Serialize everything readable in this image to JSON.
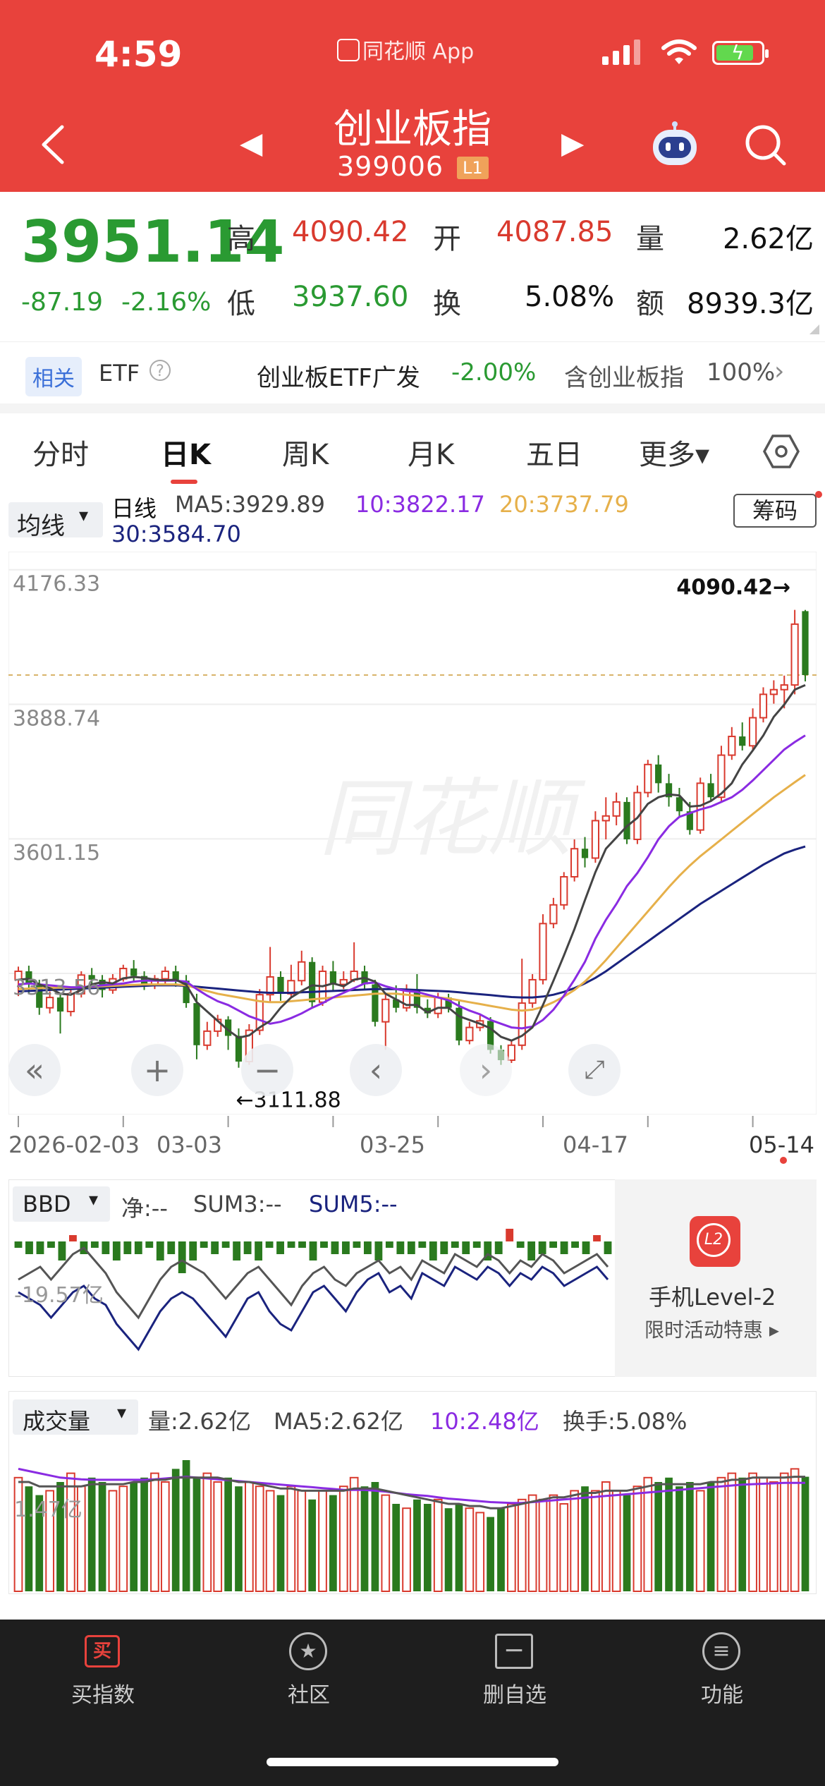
{
  "status": {
    "time": "4:59",
    "app": "同花顺 App"
  },
  "header": {
    "title": "创业板指",
    "code": "399006",
    "level": "L1"
  },
  "quote": {
    "price": "3951.14",
    "change": "-87.19",
    "change_pct": "-2.16%",
    "labels": {
      "high": "高",
      "open": "开",
      "volume": "量",
      "low": "低",
      "turnover": "换",
      "amount": "额"
    },
    "high": "4090.42",
    "open": "4087.85",
    "volume": "2.62亿",
    "low": "3937.60",
    "turnover": "5.08%",
    "amount": "8939.3亿"
  },
  "etf": {
    "tag": "相关",
    "label": "ETF",
    "help": "?",
    "name": "创业板ETF广发",
    "change": "-2.00%",
    "contains": "含创业板指",
    "pct": "100%",
    "chevron": "›"
  },
  "tabs": [
    "分时",
    "日K",
    "周K",
    "月K",
    "五日",
    "更多▾"
  ],
  "ma": {
    "select": "均线",
    "line_label": "日线",
    "ma5": "MA5:3929.89",
    "ma10": "10:3822.17",
    "ma20": "20:3737.79",
    "ma30": "30:3584.70",
    "chip": "筹码"
  },
  "colors": {
    "up": "#d93a2e",
    "down": "#2a7a1e",
    "ma5": "#444444",
    "ma10": "#8a2be2",
    "ma20": "#e6b04a",
    "ma30": "#1a237e",
    "brand": "#e8423c"
  },
  "chart_data": {
    "type": "candlestick",
    "y_ticks": [
      "4176.33",
      "3888.74",
      "3601.15",
      "3313.56"
    ],
    "ylim": [
      3024,
      4200
    ],
    "dates": [
      "2026-02-03",
      "03-03",
      "03-25",
      "04-17",
      "05-14"
    ],
    "high_marker": "4090.42→",
    "low_marker": "←3111.88",
    "last_price": 3951.14,
    "candles": [
      [
        3300,
        3318,
        3265,
        3328
      ],
      [
        3318,
        3290,
        3270,
        3330
      ],
      [
        3290,
        3240,
        3225,
        3300
      ],
      [
        3240,
        3262,
        3228,
        3275
      ],
      [
        3262,
        3232,
        3185,
        3270
      ],
      [
        3232,
        3270,
        3222,
        3282
      ],
      [
        3270,
        3310,
        3262,
        3318
      ],
      [
        3310,
        3300,
        3284,
        3325
      ],
      [
        3300,
        3278,
        3262,
        3310
      ],
      [
        3278,
        3302,
        3270,
        3312
      ],
      [
        3302,
        3324,
        3296,
        3332
      ],
      [
        3324,
        3308,
        3294,
        3342
      ],
      [
        3308,
        3288,
        3278,
        3318
      ],
      [
        3288,
        3302,
        3280,
        3310
      ],
      [
        3302,
        3318,
        3290,
        3328
      ],
      [
        3318,
        3298,
        3285,
        3330
      ],
      [
        3298,
        3250,
        3240,
        3310
      ],
      [
        3250,
        3160,
        3130,
        3270
      ],
      [
        3160,
        3190,
        3150,
        3210
      ],
      [
        3190,
        3215,
        3178,
        3225
      ],
      [
        3215,
        3180,
        3150,
        3222
      ],
      [
        3180,
        3125,
        3111.88,
        3196
      ],
      [
        3125,
        3192,
        3118,
        3205
      ],
      [
        3192,
        3268,
        3182,
        3280
      ],
      [
        3268,
        3306,
        3254,
        3370
      ],
      [
        3306,
        3270,
        3255,
        3318
      ],
      [
        3270,
        3298,
        3262,
        3332
      ],
      [
        3298,
        3338,
        3288,
        3362
      ],
      [
        3338,
        3252,
        3240,
        3348
      ],
      [
        3252,
        3318,
        3244,
        3330
      ],
      [
        3318,
        3290,
        3278,
        3340
      ],
      [
        3290,
        3300,
        3280,
        3318
      ],
      [
        3300,
        3318,
        3295,
        3380
      ],
      [
        3318,
        3290,
        3280,
        3330
      ],
      [
        3290,
        3210,
        3200,
        3300
      ],
      [
        3210,
        3258,
        3150,
        3268
      ],
      [
        3258,
        3240,
        3230,
        3288
      ],
      [
        3240,
        3278,
        3232,
        3290
      ],
      [
        3278,
        3240,
        3228,
        3312
      ],
      [
        3240,
        3228,
        3218,
        3258
      ],
      [
        3228,
        3262,
        3218,
        3272
      ],
      [
        3262,
        3240,
        3230,
        3270
      ],
      [
        3240,
        3170,
        3160,
        3255
      ],
      [
        3170,
        3198,
        3162,
        3210
      ],
      [
        3198,
        3212,
        3190,
        3224
      ],
      [
        3212,
        3150,
        3142,
        3220
      ],
      [
        3150,
        3128,
        3118,
        3160
      ],
      [
        3128,
        3160,
        3122,
        3172
      ],
      [
        3160,
        3250,
        3150,
        3345
      ],
      [
        3250,
        3300,
        3240,
        3312
      ],
      [
        3300,
        3420,
        3290,
        3440
      ],
      [
        3420,
        3460,
        3410,
        3475
      ],
      [
        3460,
        3520,
        3450,
        3530
      ],
      [
        3520,
        3580,
        3510,
        3600
      ],
      [
        3580,
        3560,
        3540,
        3605
      ],
      [
        3560,
        3640,
        3550,
        3660
      ],
      [
        3640,
        3650,
        3600,
        3690
      ],
      [
        3650,
        3680,
        3630,
        3700
      ],
      [
        3680,
        3600,
        3590,
        3690
      ],
      [
        3600,
        3700,
        3590,
        3715
      ],
      [
        3700,
        3760,
        3690,
        3770
      ],
      [
        3760,
        3720,
        3700,
        3780
      ],
      [
        3720,
        3690,
        3670,
        3740
      ],
      [
        3690,
        3660,
        3650,
        3710
      ],
      [
        3660,
        3620,
        3610,
        3680
      ],
      [
        3620,
        3720,
        3612,
        3732
      ],
      [
        3720,
        3690,
        3680,
        3740
      ],
      [
        3690,
        3780,
        3682,
        3800
      ],
      [
        3780,
        3820,
        3770,
        3840
      ],
      [
        3820,
        3800,
        3790,
        3850
      ],
      [
        3800,
        3860,
        3790,
        3880
      ],
      [
        3860,
        3910,
        3850,
        3925
      ],
      [
        3910,
        3920,
        3890,
        3940
      ],
      [
        3920,
        3930,
        3880,
        3950
      ],
      [
        3930,
        4060,
        3910,
        4090.42
      ],
      [
        4087.85,
        3951.14,
        3937.6,
        4090.42
      ]
    ],
    "ma5": [
      3300,
      3302,
      3290,
      3282,
      3270,
      3268,
      3278,
      3290,
      3295,
      3292,
      3303,
      3306,
      3304,
      3300,
      3299,
      3300,
      3289,
      3252,
      3232,
      3212,
      3192,
      3176,
      3181,
      3198,
      3212,
      3240,
      3262,
      3276,
      3288,
      3286,
      3292,
      3286,
      3300,
      3304,
      3296,
      3270,
      3258,
      3246,
      3246,
      3230,
      3240,
      3240,
      3222,
      3214,
      3206,
      3196,
      3178,
      3170,
      3180,
      3198,
      3246,
      3298,
      3352,
      3408,
      3470,
      3530,
      3580,
      3604,
      3628,
      3646,
      3676,
      3690,
      3696,
      3694,
      3670,
      3672,
      3682,
      3698,
      3720,
      3760,
      3790,
      3822,
      3862,
      3888,
      3920,
      3929.89
    ],
    "ma10": [
      3290,
      3292,
      3290,
      3288,
      3286,
      3284,
      3284,
      3286,
      3288,
      3290,
      3292,
      3296,
      3298,
      3298,
      3298,
      3298,
      3296,
      3280,
      3266,
      3254,
      3246,
      3234,
      3222,
      3214,
      3206,
      3210,
      3218,
      3228,
      3240,
      3250,
      3262,
      3272,
      3282,
      3292,
      3294,
      3286,
      3280,
      3276,
      3274,
      3268,
      3262,
      3256,
      3244,
      3234,
      3226,
      3214,
      3206,
      3198,
      3196,
      3200,
      3214,
      3236,
      3266,
      3300,
      3338,
      3388,
      3428,
      3462,
      3500,
      3528,
      3562,
      3600,
      3628,
      3648,
      3656,
      3664,
      3670,
      3680,
      3690,
      3706,
      3726,
      3748,
      3770,
      3792,
      3808,
      3822.17
    ],
    "ma20": [
      3280,
      3281,
      3282,
      3283,
      3283,
      3283,
      3284,
      3285,
      3286,
      3287,
      3288,
      3289,
      3290,
      3290,
      3290,
      3290,
      3288,
      3282,
      3276,
      3270,
      3266,
      3262,
      3258,
      3254,
      3252,
      3252,
      3254,
      3256,
      3258,
      3260,
      3262,
      3264,
      3266,
      3268,
      3270,
      3270,
      3270,
      3268,
      3266,
      3264,
      3262,
      3260,
      3256,
      3252,
      3248,
      3244,
      3240,
      3236,
      3234,
      3236,
      3242,
      3252,
      3264,
      3278,
      3296,
      3318,
      3342,
      3368,
      3394,
      3420,
      3446,
      3472,
      3498,
      3522,
      3544,
      3564,
      3582,
      3600,
      3618,
      3636,
      3654,
      3672,
      3690,
      3706,
      3722,
      3737.79
    ],
    "ma30": [
      3275,
      3276,
      3277,
      3278,
      3279,
      3280,
      3281,
      3282,
      3283,
      3284,
      3285,
      3286,
      3287,
      3288,
      3288,
      3288,
      3287,
      3285,
      3283,
      3281,
      3279,
      3277,
      3275,
      3273,
      3272,
      3272,
      3272,
      3273,
      3274,
      3275,
      3276,
      3277,
      3278,
      3279,
      3280,
      3280,
      3280,
      3279,
      3278,
      3277,
      3276,
      3275,
      3273,
      3271,
      3269,
      3267,
      3265,
      3263,
      3262,
      3262,
      3264,
      3268,
      3274,
      3282,
      3292,
      3304,
      3318,
      3334,
      3350,
      3366,
      3382,
      3398,
      3414,
      3430,
      3446,
      3462,
      3476,
      3490,
      3504,
      3518,
      3532,
      3546,
      3558,
      3570,
      3578,
      3584.7
    ]
  },
  "controls": {
    "rewind": "«",
    "zoom_in": "+",
    "zoom_out": "−",
    "left": "‹",
    "right": "›",
    "fullscreen": "⤢"
  },
  "bbd": {
    "select": "BBD",
    "net": "净:--",
    "sum3": "SUM3:--",
    "sum5": "SUM5:--",
    "axis": "-19.57亿",
    "bars": [
      -1,
      -2,
      -2,
      -1,
      -3,
      1,
      -2,
      -1,
      -2,
      -3,
      -2,
      -2,
      -1,
      -3,
      -2,
      -5,
      -3,
      -1,
      -2,
      -1,
      -3,
      -2,
      -3,
      -1,
      -2,
      -1,
      -1,
      -3,
      -1,
      -2,
      -2,
      -1,
      -2,
      -3,
      -1,
      -2,
      -2,
      -1,
      -3,
      -2,
      -1,
      -2,
      -1,
      -3,
      -2,
      2,
      -1,
      -3,
      -2,
      -1,
      -2,
      -1,
      -2,
      1,
      -2
    ],
    "line1": [
      -6,
      -5,
      -4,
      -6,
      -4,
      -2,
      -1,
      -3,
      -5,
      -8,
      -10,
      -12,
      -9,
      -6,
      -4,
      -3,
      -4,
      -5,
      -7,
      -9,
      -7,
      -5,
      -4,
      -6,
      -8,
      -10,
      -7,
      -5,
      -4,
      -6,
      -7,
      -5,
      -4,
      -3,
      -5,
      -4,
      -6,
      -3,
      -4,
      -5,
      -2,
      -3,
      -4,
      -2,
      -3,
      -5,
      -3,
      -4,
      -2,
      -3,
      -5,
      -4,
      -3,
      -2,
      -4
    ],
    "line2": [
      -8,
      -9,
      -10,
      -12,
      -10,
      -8,
      -7,
      -9,
      -10,
      -13,
      -15,
      -17,
      -14,
      -11,
      -9,
      -8,
      -9,
      -11,
      -13,
      -15,
      -12,
      -9,
      -8,
      -11,
      -13,
      -14,
      -11,
      -8,
      -7,
      -9,
      -11,
      -8,
      -6,
      -5,
      -8,
      -7,
      -9,
      -5,
      -6,
      -7,
      -4,
      -5,
      -6,
      -4,
      -5,
      -7,
      -5,
      -6,
      -4,
      -5,
      -7,
      -6,
      -5,
      -4,
      -6
    ]
  },
  "promo": {
    "logo": "L2",
    "title": "手机Level-2",
    "subtitle": "限时活动特惠 ▸"
  },
  "volume": {
    "select": "成交量",
    "vol": "量:2.62亿",
    "ma5": "MA5:2.62亿",
    "ma10": "10:2.48亿",
    "turnover": "换手:5.08%",
    "axis": "1.47亿",
    "bars": [
      2.6,
      2.4,
      2.2,
      2.3,
      2.5,
      2.7,
      2.4,
      2.6,
      2.5,
      2.3,
      2.4,
      2.5,
      2.6,
      2.7,
      2.5,
      2.8,
      3.0,
      2.6,
      2.7,
      2.5,
      2.6,
      2.4,
      2.5,
      2.4,
      2.3,
      2.2,
      2.4,
      2.3,
      2.1,
      2.3,
      2.2,
      2.4,
      2.6,
      2.4,
      2.5,
      2.2,
      2.0,
      1.9,
      2.1,
      2.0,
      2.1,
      1.9,
      2.0,
      1.9,
      1.8,
      1.7,
      1.9,
      2.0,
      2.1,
      2.2,
      2.1,
      2.2,
      2.0,
      2.3,
      2.4,
      2.3,
      2.5,
      2.3,
      2.2,
      2.4,
      2.6,
      2.5,
      2.6,
      2.4,
      2.5,
      2.3,
      2.5,
      2.6,
      2.7,
      2.6,
      2.7,
      2.6,
      2.5,
      2.7,
      2.8,
      2.62
    ],
    "ma_a": [
      2.5,
      2.5,
      2.4,
      2.4,
      2.4,
      2.4,
      2.4,
      2.45,
      2.45,
      2.45,
      2.45,
      2.5,
      2.5,
      2.55,
      2.55,
      2.6,
      2.6,
      2.6,
      2.6,
      2.6,
      2.55,
      2.5,
      2.5,
      2.45,
      2.4,
      2.35,
      2.35,
      2.3,
      2.3,
      2.3,
      2.3,
      2.3,
      2.35,
      2.35,
      2.35,
      2.3,
      2.25,
      2.2,
      2.15,
      2.1,
      2.05,
      2.0,
      2.0,
      1.95,
      1.95,
      1.9,
      1.9,
      1.95,
      2.0,
      2.05,
      2.1,
      2.15,
      2.15,
      2.2,
      2.25,
      2.25,
      2.3,
      2.3,
      2.3,
      2.35,
      2.4,
      2.45,
      2.45,
      2.45,
      2.45,
      2.45,
      2.5,
      2.5,
      2.55,
      2.55,
      2.6,
      2.6,
      2.6,
      2.6,
      2.62,
      2.62
    ],
    "ma_b": [
      2.8,
      2.75,
      2.7,
      2.65,
      2.6,
      2.58,
      2.56,
      2.55,
      2.55,
      2.55,
      2.55,
      2.55,
      2.55,
      2.56,
      2.58,
      2.6,
      2.62,
      2.6,
      2.58,
      2.56,
      2.54,
      2.52,
      2.5,
      2.48,
      2.46,
      2.44,
      2.42,
      2.4,
      2.38,
      2.36,
      2.34,
      2.32,
      2.32,
      2.32,
      2.3,
      2.28,
      2.25,
      2.22,
      2.2,
      2.18,
      2.15,
      2.12,
      2.1,
      2.08,
      2.06,
      2.04,
      2.03,
      2.02,
      2.02,
      2.04,
      2.06,
      2.08,
      2.1,
      2.12,
      2.14,
      2.16,
      2.18,
      2.2,
      2.22,
      2.24,
      2.26,
      2.28,
      2.3,
      2.32,
      2.34,
      2.36,
      2.38,
      2.4,
      2.42,
      2.44,
      2.45,
      2.46,
      2.47,
      2.48,
      2.48,
      2.48
    ]
  },
  "nav": [
    {
      "label": "买指数",
      "icon": "买"
    },
    {
      "label": "社区",
      "icon": "★"
    },
    {
      "label": "删自选",
      "icon": "−"
    },
    {
      "label": "功能",
      "icon": "≡"
    }
  ]
}
